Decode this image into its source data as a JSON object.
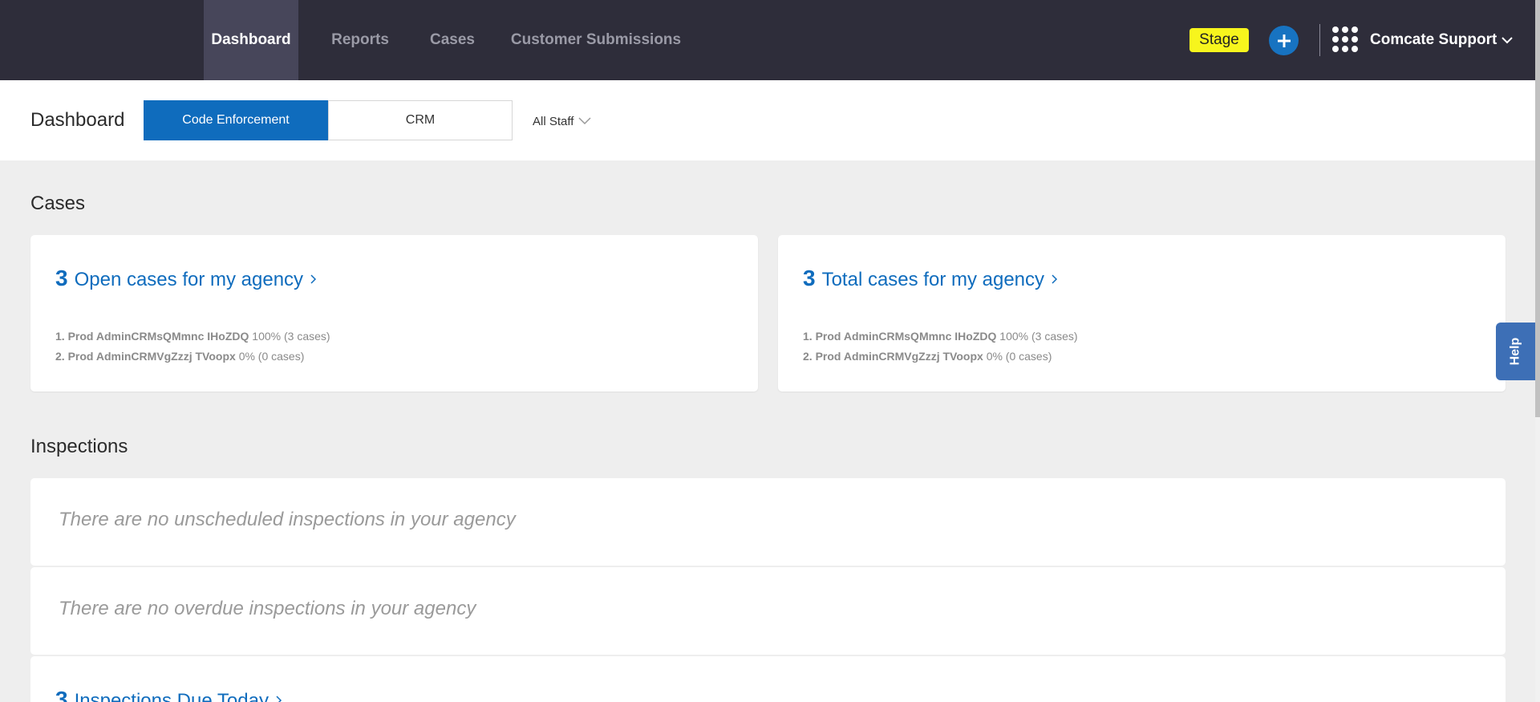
{
  "topnav": {
    "tabs": [
      {
        "label": "Dashboard",
        "active": true
      },
      {
        "label": "Reports",
        "active": false
      },
      {
        "label": "Cases",
        "active": false
      },
      {
        "label": "Customer Submissions",
        "active": false
      }
    ],
    "env_badge": "Stage",
    "add_icon": "plus-icon",
    "apps_icon": "grid-icon",
    "account_name": "Comcate Support",
    "colors": {
      "bg": "#2e2d3a",
      "active_tab": "#47465a",
      "badge": "#f7f51d",
      "accent": "#1773c1"
    }
  },
  "subheader": {
    "title": "Dashboard",
    "segments": [
      {
        "label": "Code Enforcement",
        "selected": true
      },
      {
        "label": "CRM",
        "selected": false
      }
    ],
    "staff_filter": "All Staff"
  },
  "cases": {
    "heading": "Cases",
    "cards": [
      {
        "count": "3",
        "label": "Open cases for my agency",
        "ranking": [
          {
            "rank": "1.",
            "name": "Prod AdminCRMsQMmnc IHoZDQ",
            "stat": "100% (3 cases)"
          },
          {
            "rank": "2.",
            "name": "Prod AdminCRMVgZzzj TVoopx",
            "stat": "0% (0 cases)"
          }
        ]
      },
      {
        "count": "3",
        "label": "Total cases for my agency",
        "ranking": [
          {
            "rank": "1.",
            "name": "Prod AdminCRMsQMmnc IHoZDQ",
            "stat": "100% (3 cases)"
          },
          {
            "rank": "2.",
            "name": "Prod AdminCRMVgZzzj TVoopx",
            "stat": "0% (0 cases)"
          }
        ]
      }
    ]
  },
  "inspections": {
    "heading": "Inspections",
    "unscheduled_msg": "There are no unscheduled inspections in your agency",
    "overdue_msg": "There are no overdue inspections in your agency",
    "due_today": {
      "count": "3",
      "label": "Inspections Due Today"
    }
  },
  "help_tab": "Help",
  "brand_color": "#0f6cbd"
}
